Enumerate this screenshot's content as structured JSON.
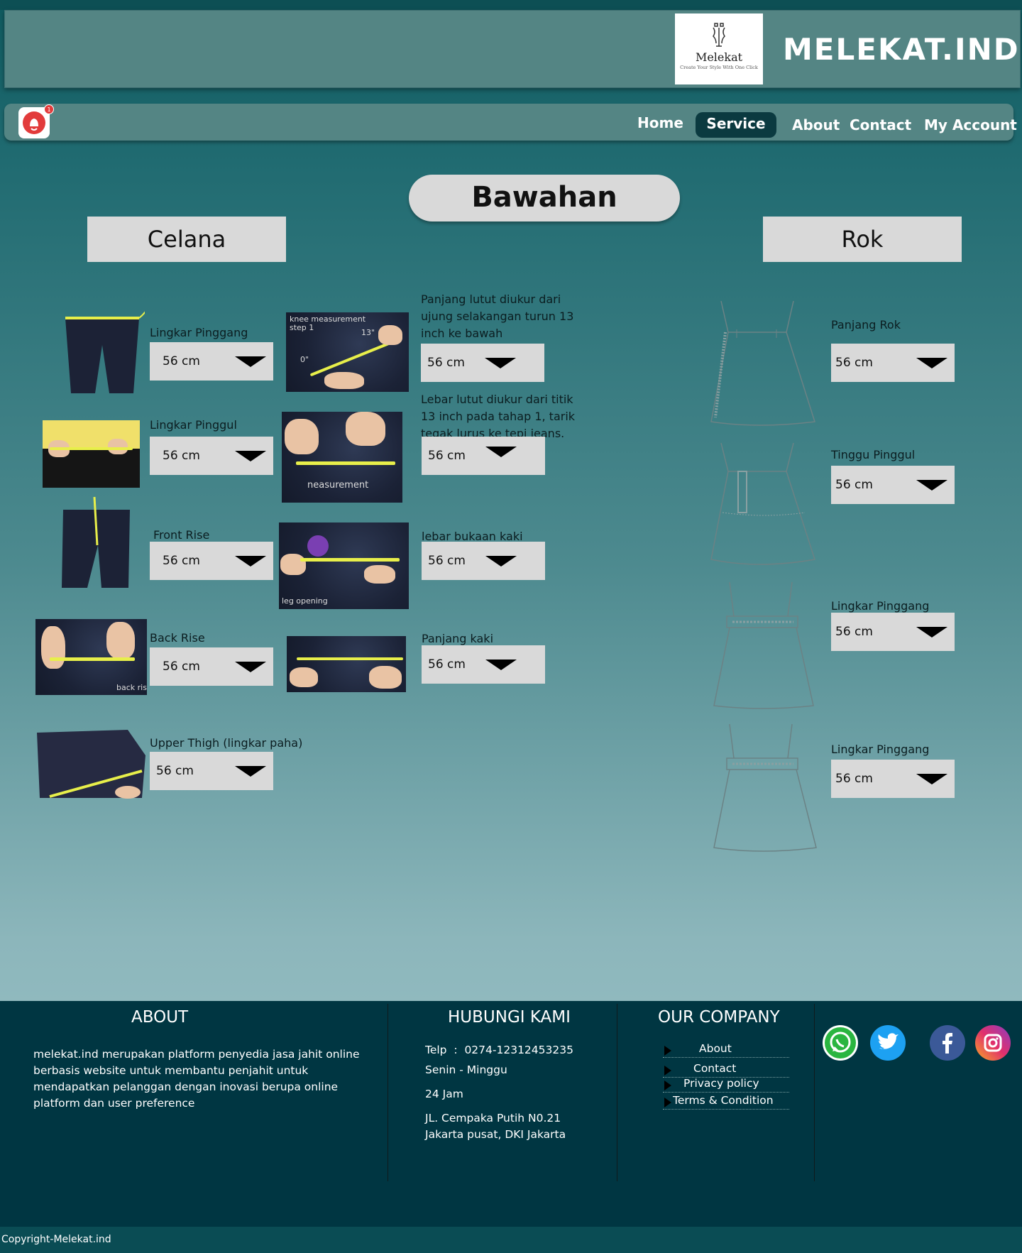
{
  "header": {
    "logo_name": "Melekat",
    "logo_tagline": "Create Your Style With One Click",
    "brand": "MELEKAT.IND"
  },
  "nav": {
    "notification_count": "1",
    "items": [
      "Home",
      "Service",
      "About",
      "Contact",
      "My Account"
    ],
    "active": "Service"
  },
  "page": {
    "title": "Bawahan",
    "left_section": "Celana",
    "right_section": "Rok"
  },
  "celana": {
    "left_fields": [
      {
        "label": "Lingkar Pinggang",
        "value": "56 cm"
      },
      {
        "label": "Lingkar Pinggul",
        "value": "56 cm"
      },
      {
        "label": "Front Rise",
        "value": "56 cm"
      },
      {
        "label": "Back Rise",
        "value": "56 cm"
      },
      {
        "label": "Upper Thigh (lingkar paha)",
        "value": "56 cm"
      }
    ],
    "right_fields": [
      {
        "label": "Panjang lutut diukur dari ujung selakangan turun 13 inch ke bawah",
        "value": "56 cm"
      },
      {
        "label": "Lebar lutut diukur dari titik 13 inch pada tahap 1, tarik tegak lurus ke tepi jeans.",
        "value": "56 cm"
      },
      {
        "label": "lebar bukaan kaki",
        "value": "56 cm"
      },
      {
        "label": "Panjang kaki",
        "value": "56 cm"
      }
    ],
    "photo_captions": {
      "knee": "knee measurement\nstep 1",
      "knee_ticks": "13\"",
      "knee_zero": "0\"",
      "measurement": "neasurement",
      "leg_opening": "leg opening",
      "back_rise": "back rise"
    }
  },
  "rok": {
    "fields": [
      {
        "label": "Panjang Rok",
        "value": "56 cm"
      },
      {
        "label": "Tinggu Pinggul",
        "value": "56 cm"
      },
      {
        "label": "Lingkar Pinggang",
        "value": "56 cm"
      },
      {
        "label": "Lingkar Pinggang",
        "value": "56 cm"
      }
    ]
  },
  "footer": {
    "about_title": "ABOUT",
    "about_text": "melekat.ind merupakan platform penyedia jasa jahit online berbasis website untuk membantu penjahit untuk mendapatkan pelanggan dengan inovasi berupa online platform dan user preference",
    "contact_title": "HUBUNGI KAMI",
    "phone": "Telp  :  0274-12312453235",
    "days": "Senin - Minggu",
    "hours": "24 Jam",
    "address": "JL. Cempaka Putih N0.21 Jakarta pusat, DKI Jakarta",
    "company_title": "OUR COMPANY",
    "company_links": [
      "About",
      "Contact",
      "Privacy policy",
      "Terms & Condition"
    ],
    "social": [
      "whatsapp-icon",
      "twitter-icon",
      "facebook-icon",
      "instagram-icon"
    ],
    "copyright": "Copyright-Melekat.ind"
  },
  "colors": {
    "nav_bg": "#548584",
    "active_nav": "#0b3a40",
    "footer_bg": "#003642",
    "select_bg": "#d9d9d9"
  }
}
